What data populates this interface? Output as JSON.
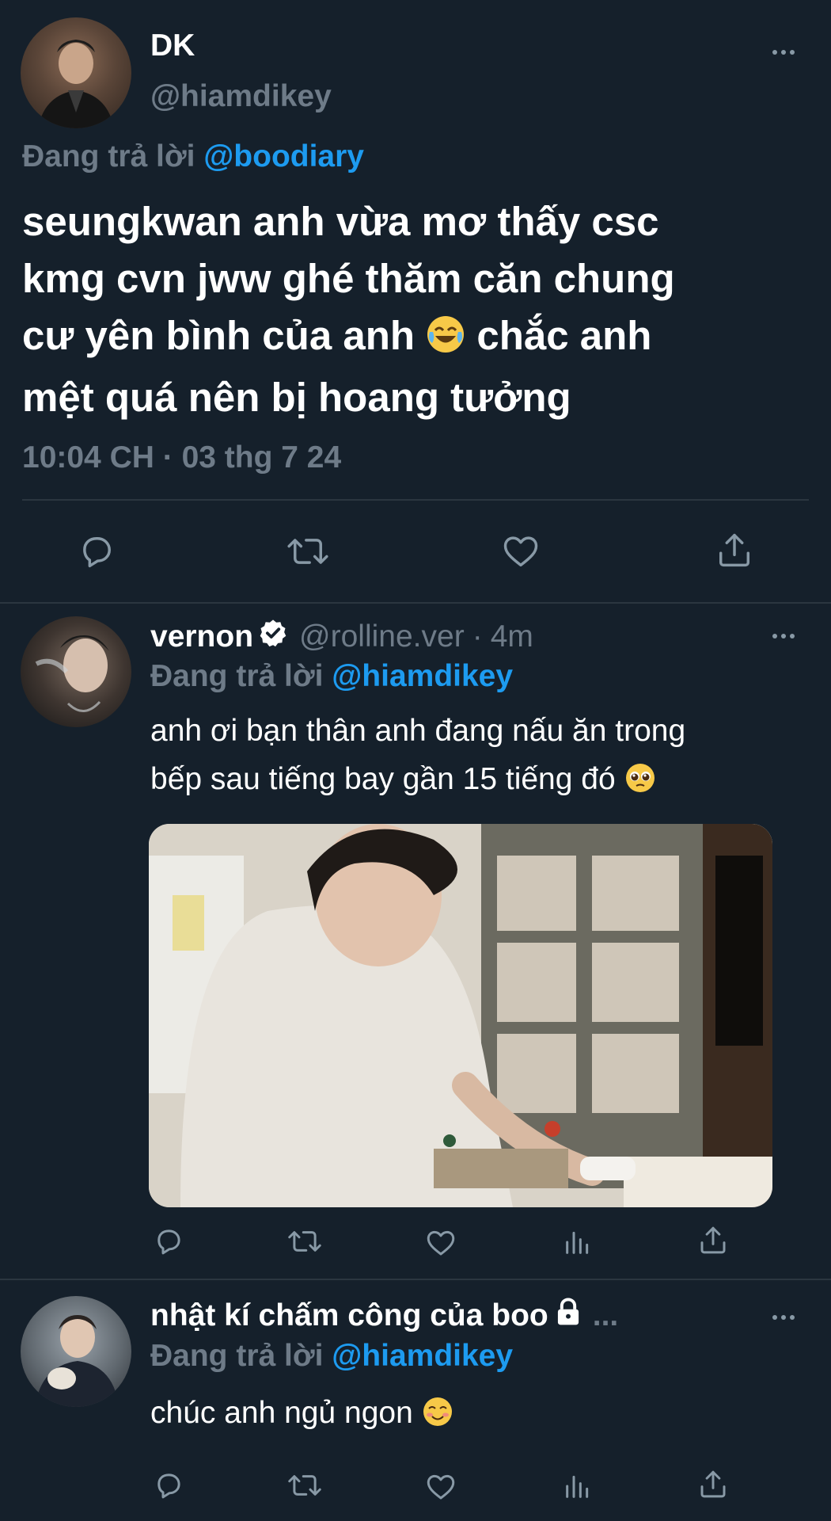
{
  "main_tweet": {
    "author_name": "DK",
    "author_handle": "@hiamdikey",
    "replying_prefix": "Đang trả lời",
    "replying_to": "@boodiary",
    "text_line1": "seungkwan anh vừa mơ thấy csc",
    "text_line2": "kmg cvn jww ghé thăm căn chung",
    "text_line3": "cư yên bình của anh",
    "text_line3_after": "chắc anh",
    "text_line4": "mệt quá nên bị hoang tưởng",
    "emoji_1": "joy",
    "timestamp": "10:04 CH · 03 thg 7 24",
    "actions": [
      "reply-icon",
      "retweet-icon",
      "like-icon",
      "share-icon"
    ]
  },
  "reply1": {
    "author_name": "vernon",
    "verified_icon": "verified-badge-icon",
    "author_handle": "@rolline.ver",
    "separator": "·",
    "time": "4m",
    "replying_prefix": "Đang trả lời",
    "replying_to": "@hiamdikey",
    "text_line1": "anh ơi bạn thân anh đang nấu ăn trong",
    "text_line2": "bếp sau tiếng bay gần 15 tiếng đó",
    "emoji": "pleading-face",
    "media_alt": "video-still-person-cooking",
    "actions": [
      "reply-icon",
      "retweet-icon",
      "like-icon",
      "analytics-icon",
      "share-icon"
    ]
  },
  "reply2": {
    "author_name": "nhật kí chấm công của boo",
    "lock_icon": "lock-icon",
    "truncation": "...",
    "replying_prefix": "Đang trả lời",
    "replying_to": "@hiamdikey",
    "text": "chúc anh ngủ ngon",
    "emoji": "smiling-face",
    "actions": [
      "reply-icon",
      "retweet-icon",
      "like-icon",
      "analytics-icon",
      "share-icon"
    ]
  },
  "colors": {
    "background": "#15202b",
    "text": "#ffffff",
    "muted": "#6e7b88",
    "link": "#1d9bf0",
    "divider": "#2b3640"
  }
}
